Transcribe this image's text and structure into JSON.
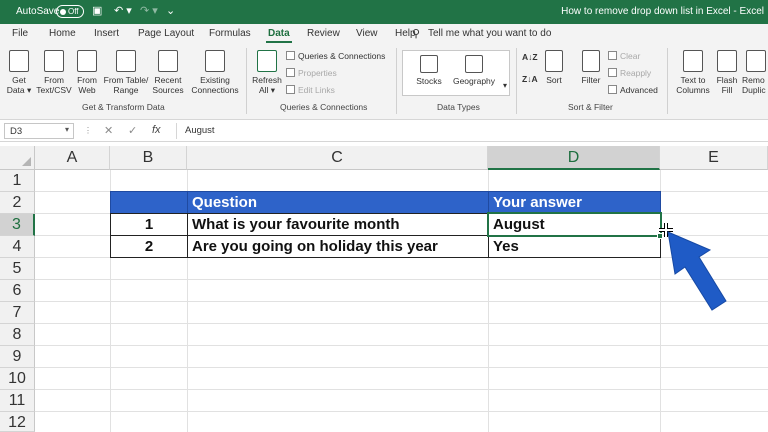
{
  "titlebar": {
    "autosave_label": "AutoSave",
    "toggle_state": "Off",
    "doc_title": "How to remove drop down list in Excel  -  Excel"
  },
  "tabs": [
    "File",
    "Home",
    "Insert",
    "Page Layout",
    "Formulas",
    "Data",
    "Review",
    "View",
    "Help"
  ],
  "active_tab": "Data",
  "tell_me": "Tell me what you want to do",
  "ribbon": {
    "get_data": "Get Data",
    "from_text_csv": "From Text/CSV",
    "from_web": "From Web",
    "from_table_range": "From Table/ Range",
    "recent_sources": "Recent Sources",
    "existing_connections": "Existing Connections",
    "group_get_transform": "Get & Transform Data",
    "refresh_all": "Refresh All",
    "queries_connections": "Queries & Connections",
    "properties": "Properties",
    "edit_links": "Edit Links",
    "group_queries": "Queries & Connections",
    "stocks": "Stocks",
    "geography": "Geography",
    "group_datatypes": "Data Types",
    "sort": "Sort",
    "filter": "Filter",
    "clear": "Clear",
    "reapply": "Reapply",
    "advanced": "Advanced",
    "group_sortfilter": "Sort & Filter",
    "text_to_columns": "Text to Columns",
    "flash_fill": "Flash Fill",
    "remove_duplicates": "Remo Duplic"
  },
  "formula_bar": {
    "name_box": "D3",
    "value": "August"
  },
  "columns": [
    "A",
    "B",
    "C",
    "D",
    "E"
  ],
  "rows": [
    "1",
    "2",
    "3",
    "4",
    "5",
    "6",
    "7",
    "8",
    "9",
    "10",
    "11",
    "12"
  ],
  "table": {
    "header_question": "Question",
    "header_answer": "Your answer",
    "row1": {
      "num": "1",
      "question": "What is your favourite month",
      "answer": "August"
    },
    "row2": {
      "num": "2",
      "question": "Are you going on holiday this year",
      "answer": "Yes"
    }
  },
  "colors": {
    "excel_green": "#217346",
    "table_header_blue": "#2e63c9",
    "arrow_blue": "#1f5bc6"
  }
}
